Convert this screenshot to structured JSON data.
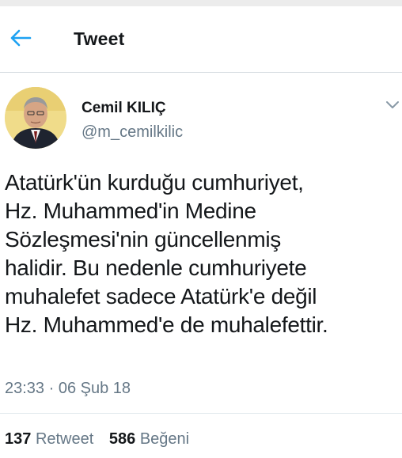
{
  "header": {
    "title": "Tweet"
  },
  "author": {
    "name": "Cemil KILIÇ",
    "handle": "@m_cemilkilic"
  },
  "tweet": {
    "text": "Atatürk'ün kurduğu cumhuriyet,\nHz. Muhammed'in Medine\nSözleşmesi'nin güncellenmiş\nhalidir. Bu nedenle cumhuriyete\nmuhalefet sadece Atatürk'e değil\nHz. Muhammed'e de muhalefettir.",
    "timestamp": "23:33 · 06 Şub 18"
  },
  "stats": {
    "retweets_count": "137",
    "retweets_label": "Retweet",
    "likes_count": "586",
    "likes_label": "Beğeni"
  },
  "icons": {
    "back": "back-arrow-icon",
    "more": "chevron-down-icon"
  },
  "colors": {
    "accent": "#1da1f2",
    "text_primary": "#14171a",
    "text_secondary": "#657786",
    "divider": "#e1e8ed"
  }
}
